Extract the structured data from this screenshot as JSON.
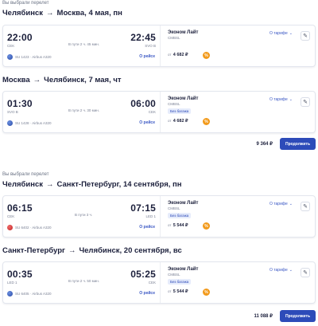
{
  "bookings": [
    {
      "caption": "Вы выбрали перелет",
      "total": "9 364 ₽",
      "continue_label": "Продолжить",
      "segments": [
        {
          "from": "Челябинск",
          "to": "Москва",
          "date": "4 мая, пн",
          "dep_time": "22:00",
          "arr_time": "22:45",
          "dep_airport": "CEK",
          "arr_airport": "SVO B",
          "duration": "В пути 2 ч. 45 мин.",
          "flight": "SU 1423 · Airbus A320",
          "about": "О рейсе",
          "fare_name": "Эконом Лайт",
          "fare_code": "CMBSL",
          "baggage": "",
          "price_prefix": "от",
          "price": "4 682 ₽",
          "pct": "%",
          "tariff": "О тарифе"
        },
        {
          "from": "Москва",
          "to": "Челябинск",
          "date": "7 мая, чт",
          "dep_time": "01:30",
          "arr_time": "06:00",
          "dep_airport": "SVO B",
          "arr_airport": "CEK",
          "duration": "В пути 2 ч. 30 мин.",
          "flight": "SU 1428 · Airbus A320",
          "about": "О рейсе",
          "fare_name": "Эконом Лайт",
          "fare_code": "CMBSL",
          "baggage": "Без багажа",
          "price_prefix": "от",
          "price": "4 682 ₽",
          "pct": "%",
          "tariff": "О тарифе"
        }
      ]
    },
    {
      "caption": "Вы выбрали перелет",
      "total": "11 088 ₽",
      "continue_label": "Продолжить",
      "segments": [
        {
          "from": "Челябинск",
          "to": "Санкт-Петербург",
          "date": "14 сентября, пн",
          "dep_time": "06:15",
          "arr_time": "07:15",
          "dep_airport": "CEK",
          "arr_airport": "LED 1",
          "duration": "В пути 3 ч.",
          "flight": "SU 6402 · Airbus A320",
          "about": "О рейсе",
          "fare_name": "Эконом Лайт",
          "fare_code": "CMBSL",
          "baggage": "Без багажа",
          "price_prefix": "от",
          "price": "5 544 ₽",
          "pct": "%",
          "tariff": "О тарифе"
        },
        {
          "from": "Санкт-Петербург",
          "to": "Челябинск",
          "date": "20 сентября, вс",
          "dep_time": "00:35",
          "arr_time": "05:25",
          "dep_airport": "LED 1",
          "arr_airport": "CEK",
          "duration": "В пути 2 ч. 50 мин.",
          "flight": "SU 6405 · Airbus A320",
          "about": "О рейсе",
          "fare_name": "Эконом Лайт",
          "fare_code": "CMBSL",
          "baggage": "Без багажа",
          "price_prefix": "от",
          "price": "5 544 ₽",
          "pct": "%",
          "tariff": "О тарифе"
        }
      ]
    }
  ]
}
